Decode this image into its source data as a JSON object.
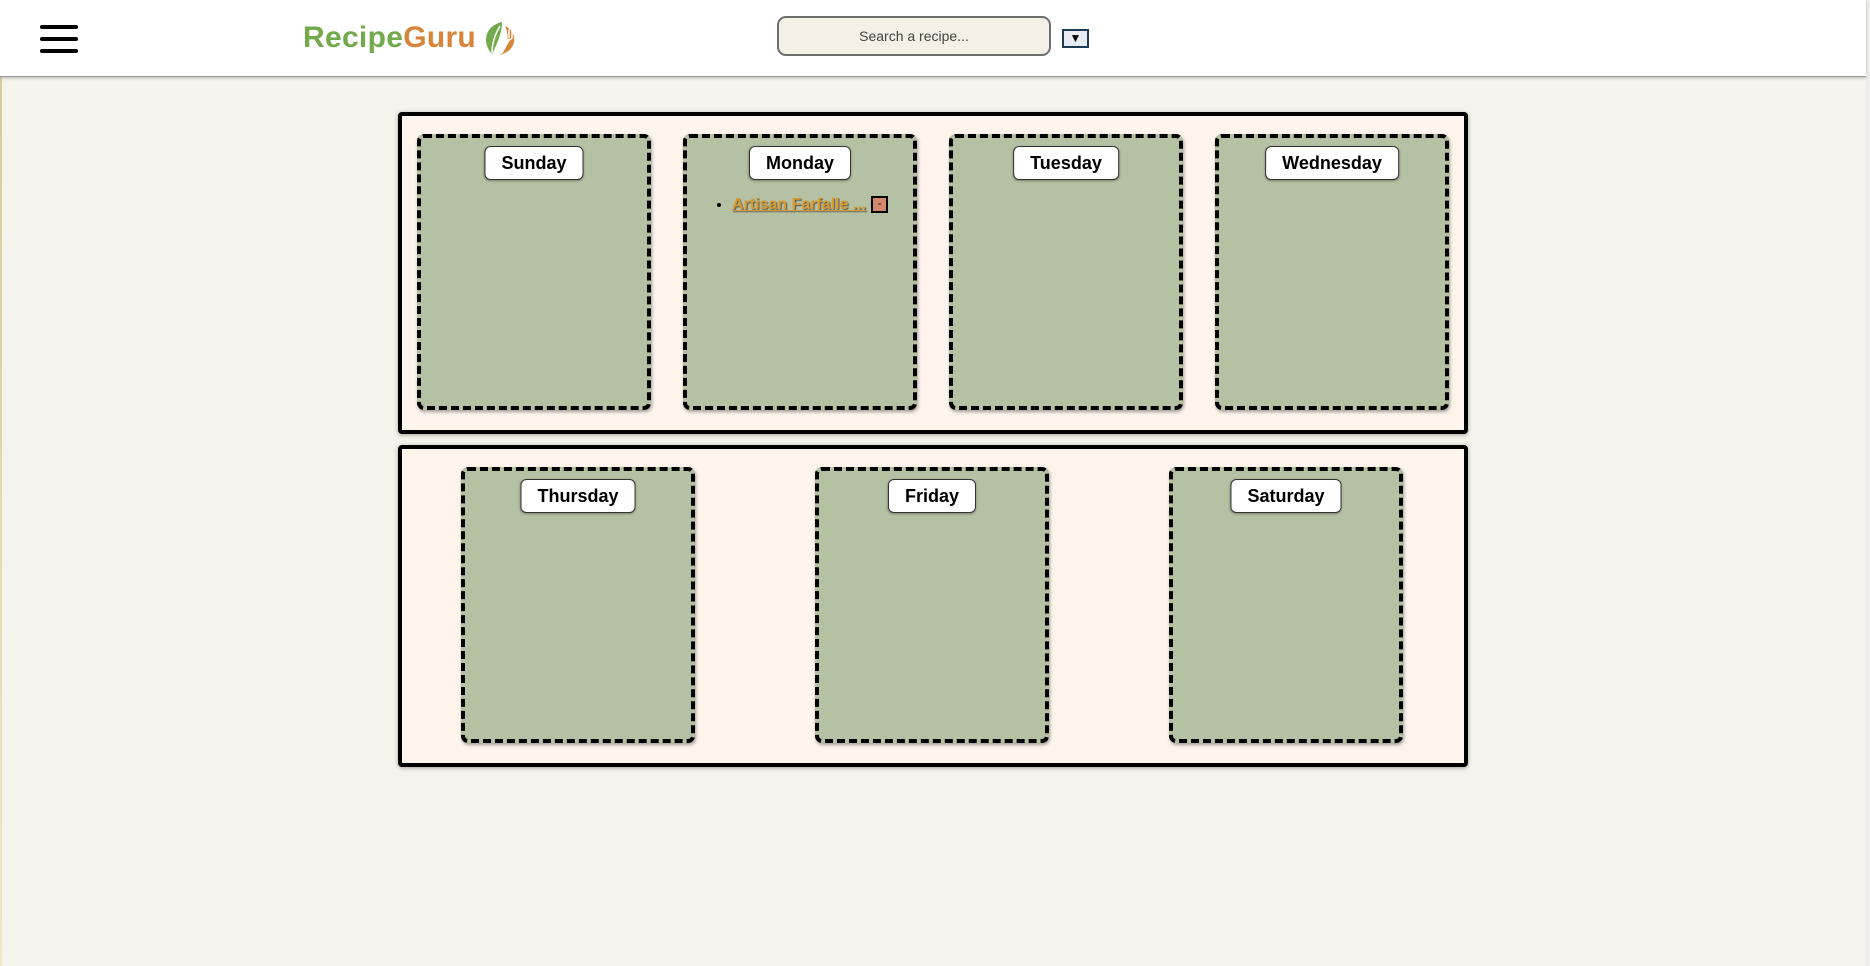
{
  "header": {
    "menu_icon": "hamburger-menu-icon",
    "logo": {
      "part1": "Recipe",
      "part2": "Guru",
      "icon": "leaf-fork-icon"
    },
    "search": {
      "placeholder": "Search a recipe...",
      "value": ""
    },
    "dropdown_label": "▼"
  },
  "colors": {
    "page_bg": "#f5f4ec",
    "panel_bg": "#fdf5ec",
    "card_bg": "#b4c1a3",
    "logo_green": "#73aa4b",
    "logo_orange": "#d8853c",
    "recipe_link": "#d89a2a",
    "remove_button": "#d5866e"
  },
  "week": {
    "row1": [
      {
        "day": "Sunday",
        "recipes": []
      },
      {
        "day": "Monday",
        "recipes": [
          {
            "name": "Artisan Farfalle ...",
            "remove_label": "-"
          }
        ]
      },
      {
        "day": "Tuesday",
        "recipes": []
      },
      {
        "day": "Wednesday",
        "recipes": []
      }
    ],
    "row2": [
      {
        "day": "Thursday",
        "recipes": []
      },
      {
        "day": "Friday",
        "recipes": []
      },
      {
        "day": "Saturday",
        "recipes": []
      }
    ]
  }
}
